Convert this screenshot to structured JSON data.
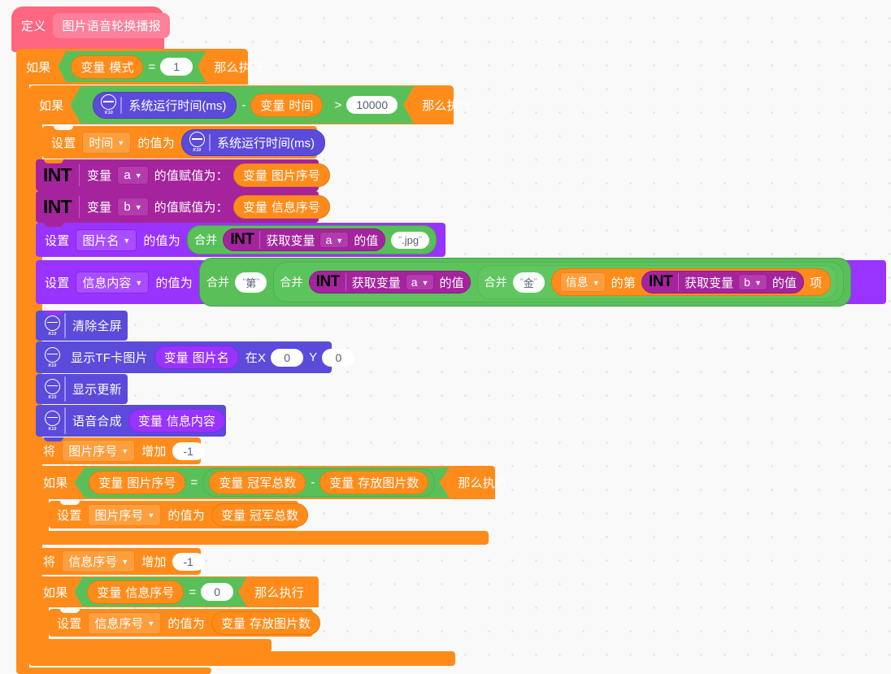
{
  "editor": {
    "type": "block-based-visual-programming-canvas",
    "background_color": "#f9f9f9",
    "grid_dot_color": "#e4e4e4"
  },
  "palette": {
    "define_hat": "#FF6680",
    "control": "#FF8C1A",
    "operator": "#59C059",
    "variable_orange": "#FF8C1A",
    "int_magenta": "#A5249E",
    "data_purple": "#9933FF",
    "device_blue": "#5B4BDB"
  },
  "script": {
    "define": {
      "keyword": "定义",
      "procedure_name": "图片语音轮换播报"
    },
    "if_mode": {
      "if_label": "如果",
      "then_label": "那么执行",
      "condition": {
        "left_prefix": "变量",
        "left_name": "模式",
        "operator": "=",
        "right_value": "1"
      }
    },
    "if_timer": {
      "if_label": "如果",
      "then_label": "那么执行",
      "condition": {
        "left_device": "系统运行时间(ms)",
        "minus": "-",
        "var_prefix": "变量",
        "var_name": "时间",
        "operator": ">",
        "right_value": "10000"
      }
    },
    "set_time": {
      "set_label": "设置",
      "target": "时间",
      "value_label": "的值为",
      "value_device": "系统运行时间(ms)"
    },
    "int_a": {
      "badge": "INT",
      "var_label": "变量",
      "name": "a",
      "assign_label": "的值赋值为：",
      "value_prefix": "变量",
      "value_name": "图片序号"
    },
    "int_b": {
      "badge": "INT",
      "var_label": "变量",
      "name": "b",
      "assign_label": "的值赋值为：",
      "value_prefix": "变量",
      "value_name": "信息序号"
    },
    "set_imgname": {
      "set_label": "设置",
      "target": "图片名",
      "value_label": "的值为",
      "join_label": "合并",
      "get_badge": "INT",
      "get_label": "获取变量",
      "get_name": "a",
      "get_suffix": "的值",
      "string_literal": ".jpg"
    },
    "set_msgcontent": {
      "set_label": "设置",
      "target": "信息内容",
      "value_label": "的值为",
      "join1_label": "合并",
      "string1": "第",
      "join2_label": "合并",
      "get1_badge": "INT",
      "get1_label": "获取变量",
      "get1_name": "a",
      "get1_suffix": "的值",
      "join3_label": "合并",
      "string2": "金",
      "list_name": "信息",
      "list_mid": "的第",
      "get2_badge": "INT",
      "get2_label": "获取变量",
      "get2_name": "b",
      "get2_suffix": "的值",
      "list_tail": "项"
    },
    "clear_screen": {
      "label": "清除全屏"
    },
    "show_tf_image": {
      "label": "显示TF卡图片",
      "var_prefix": "变量",
      "var_name": "图片名",
      "x_label": "在X",
      "x_value": "0",
      "y_label": "Y",
      "y_value": "0"
    },
    "display_update": {
      "label": "显示更新"
    },
    "speech_synth": {
      "label": "语音合成",
      "var_prefix": "变量",
      "var_name": "信息内容"
    },
    "change_imgindex": {
      "change_label": "将",
      "target": "图片序号",
      "by_label": "增加",
      "value": "-1"
    },
    "if_imgindex": {
      "if_label": "如果",
      "then_label": "那么执行",
      "condition": {
        "left_prefix": "变量",
        "left_name": "图片序号",
        "operator": "=",
        "r1_prefix": "变量",
        "r1_name": "冠军总数",
        "minus": "-",
        "r2_prefix": "变量",
        "r2_name": "存放图片数"
      },
      "body": {
        "set_label": "设置",
        "target": "图片序号",
        "value_label": "的值为",
        "value_prefix": "变量",
        "value_name": "冠军总数"
      }
    },
    "change_msgindex": {
      "change_label": "将",
      "target": "信息序号",
      "by_label": "增加",
      "value": "-1"
    },
    "if_msgindex": {
      "if_label": "如果",
      "then_label": "那么执行",
      "condition": {
        "left_prefix": "变量",
        "left_name": "信息序号",
        "operator": "=",
        "right_value": "0"
      },
      "body": {
        "set_label": "设置",
        "target": "信息序号",
        "value_label": "的值为",
        "value_prefix": "变量",
        "value_name": "存放图片数"
      }
    }
  }
}
